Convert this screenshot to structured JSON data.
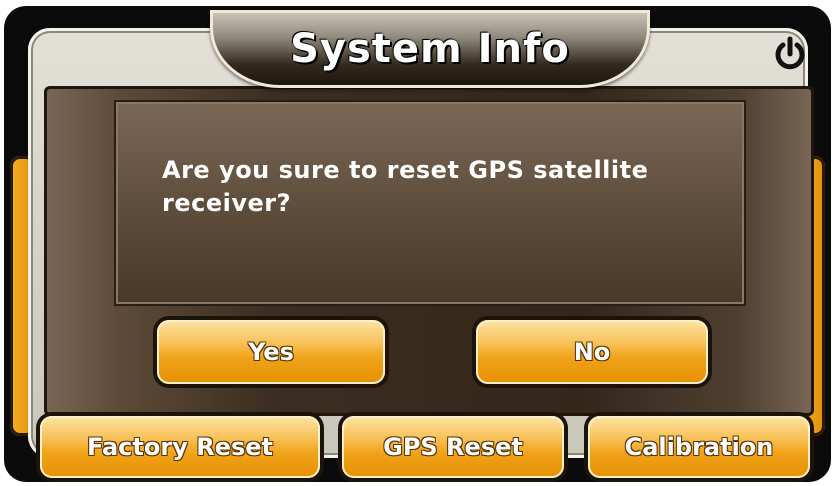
{
  "header": {
    "title": "System Info",
    "power_icon": "power-icon"
  },
  "dialog": {
    "message": "Are you sure to reset GPS satellite receiver?",
    "yes_label": "Yes",
    "no_label": "No"
  },
  "toolbar": {
    "factory_reset_label": "Factory Reset",
    "gps_reset_label": "GPS Reset",
    "calibration_label": "Calibration"
  },
  "colors": {
    "accent": "#f0a219",
    "panel": "#3b2d20",
    "frame": "#d6d3c9"
  }
}
